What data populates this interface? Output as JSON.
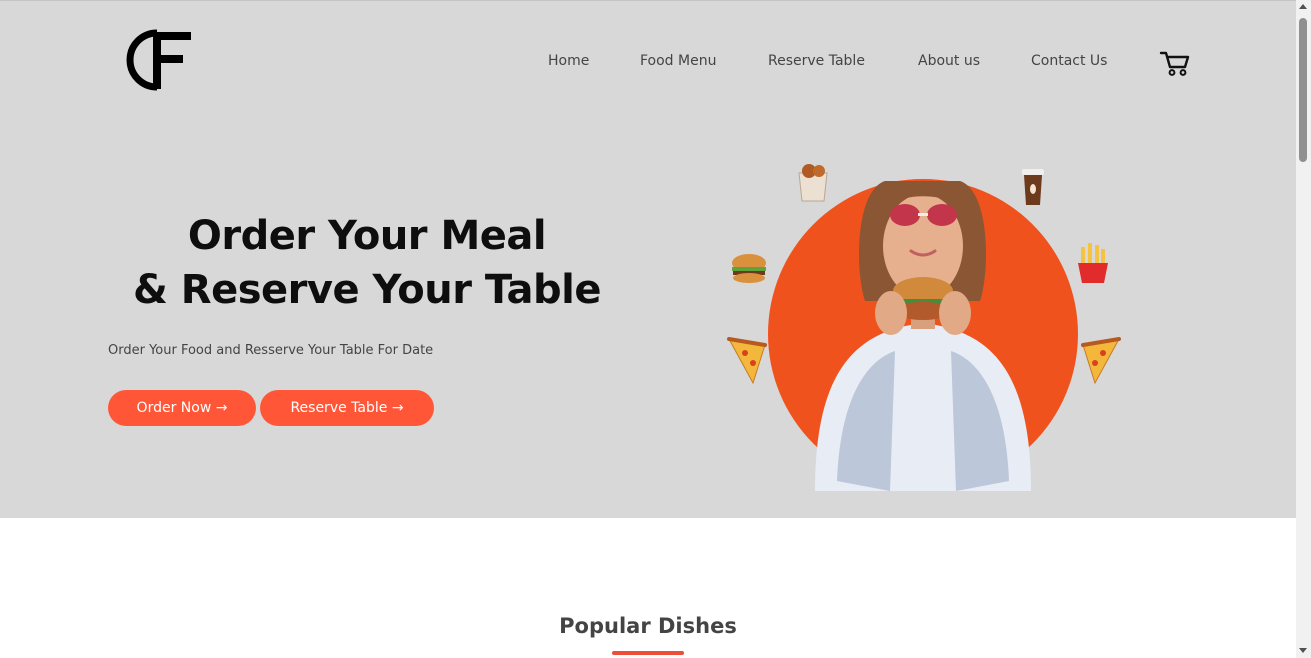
{
  "brand": {
    "logo_icon": "cf-monogram-logo"
  },
  "nav": {
    "items": [
      {
        "label": "Home"
      },
      {
        "label": "Food Menu"
      },
      {
        "label": "Reserve Table"
      },
      {
        "label": "About us"
      },
      {
        "label": "Contact Us"
      }
    ],
    "cart_icon": "shopping-cart-icon"
  },
  "hero": {
    "headline_line1": "Order Your Meal",
    "headline_line2": "& Reserve Your Table",
    "subtitle": "Order Your Food and Resserve Your Table For Date",
    "order_button": "Order Now →",
    "reserve_button": "Reserve Table →",
    "image": "woman-eating-burger-with-food-icons"
  },
  "popular": {
    "title": "Popular Dishes"
  },
  "colors": {
    "accent": "#ff5638",
    "hero_bg": "#d8d8d8",
    "circle": "#f0521d",
    "text_dark": "#0e0e0e"
  }
}
